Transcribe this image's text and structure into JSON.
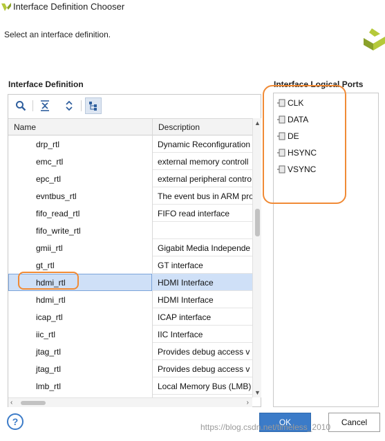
{
  "window": {
    "title": "Interface Definition Chooser"
  },
  "prompt": "Select an interface definition.",
  "left_panel": {
    "label": "Interface Definition",
    "toolbar": {
      "search_icon": "search-icon",
      "collapse_all_icon": "collapse-all-icon",
      "expand_all_icon": "expand-all-icon",
      "hierarchy_icon": "hierarchy-icon"
    },
    "columns": [
      "Name",
      "Description"
    ],
    "rows": [
      {
        "name": "drp_rtl",
        "desc": "Dynamic Reconfiguration"
      },
      {
        "name": "emc_rtl",
        "desc": "external memory controll"
      },
      {
        "name": "epc_rtl",
        "desc": "external peripheral contro"
      },
      {
        "name": "evntbus_rtl",
        "desc": "The event bus in ARM pro"
      },
      {
        "name": "fifo_read_rtl",
        "desc": "FIFO read interface"
      },
      {
        "name": "fifo_write_rtl",
        "desc": ""
      },
      {
        "name": "gmii_rtl",
        "desc": "Gigabit Media Independe"
      },
      {
        "name": "gt_rtl",
        "desc": "GT interface"
      },
      {
        "name": "hdmi_rtl",
        "desc": "HDMI Interface",
        "selected": true
      },
      {
        "name": "hdmi_rtl",
        "desc": "HDMI Interface"
      },
      {
        "name": "icap_rtl",
        "desc": "ICAP interface"
      },
      {
        "name": "iic_rtl",
        "desc": "IIC Interface"
      },
      {
        "name": "jtag_rtl",
        "desc": "Provides debug access v"
      },
      {
        "name": "jtag_rtl",
        "desc": "Provides debug access v"
      },
      {
        "name": "lmb_rtl",
        "desc": "Local Memory Bus (LMB)"
      }
    ]
  },
  "right_panel": {
    "label": "Interface Logical Ports",
    "ports": [
      "CLK",
      "DATA",
      "DE",
      "HSYNC",
      "VSYNC"
    ]
  },
  "footer": {
    "help": "?",
    "ok": "OK",
    "cancel": "Cancel",
    "watermark": "https://blog.csdn.net/timeless_2010"
  },
  "colors": {
    "accent": "#3b7bc8",
    "selection": "#cfe0f7",
    "annotation": "#f08a35"
  }
}
